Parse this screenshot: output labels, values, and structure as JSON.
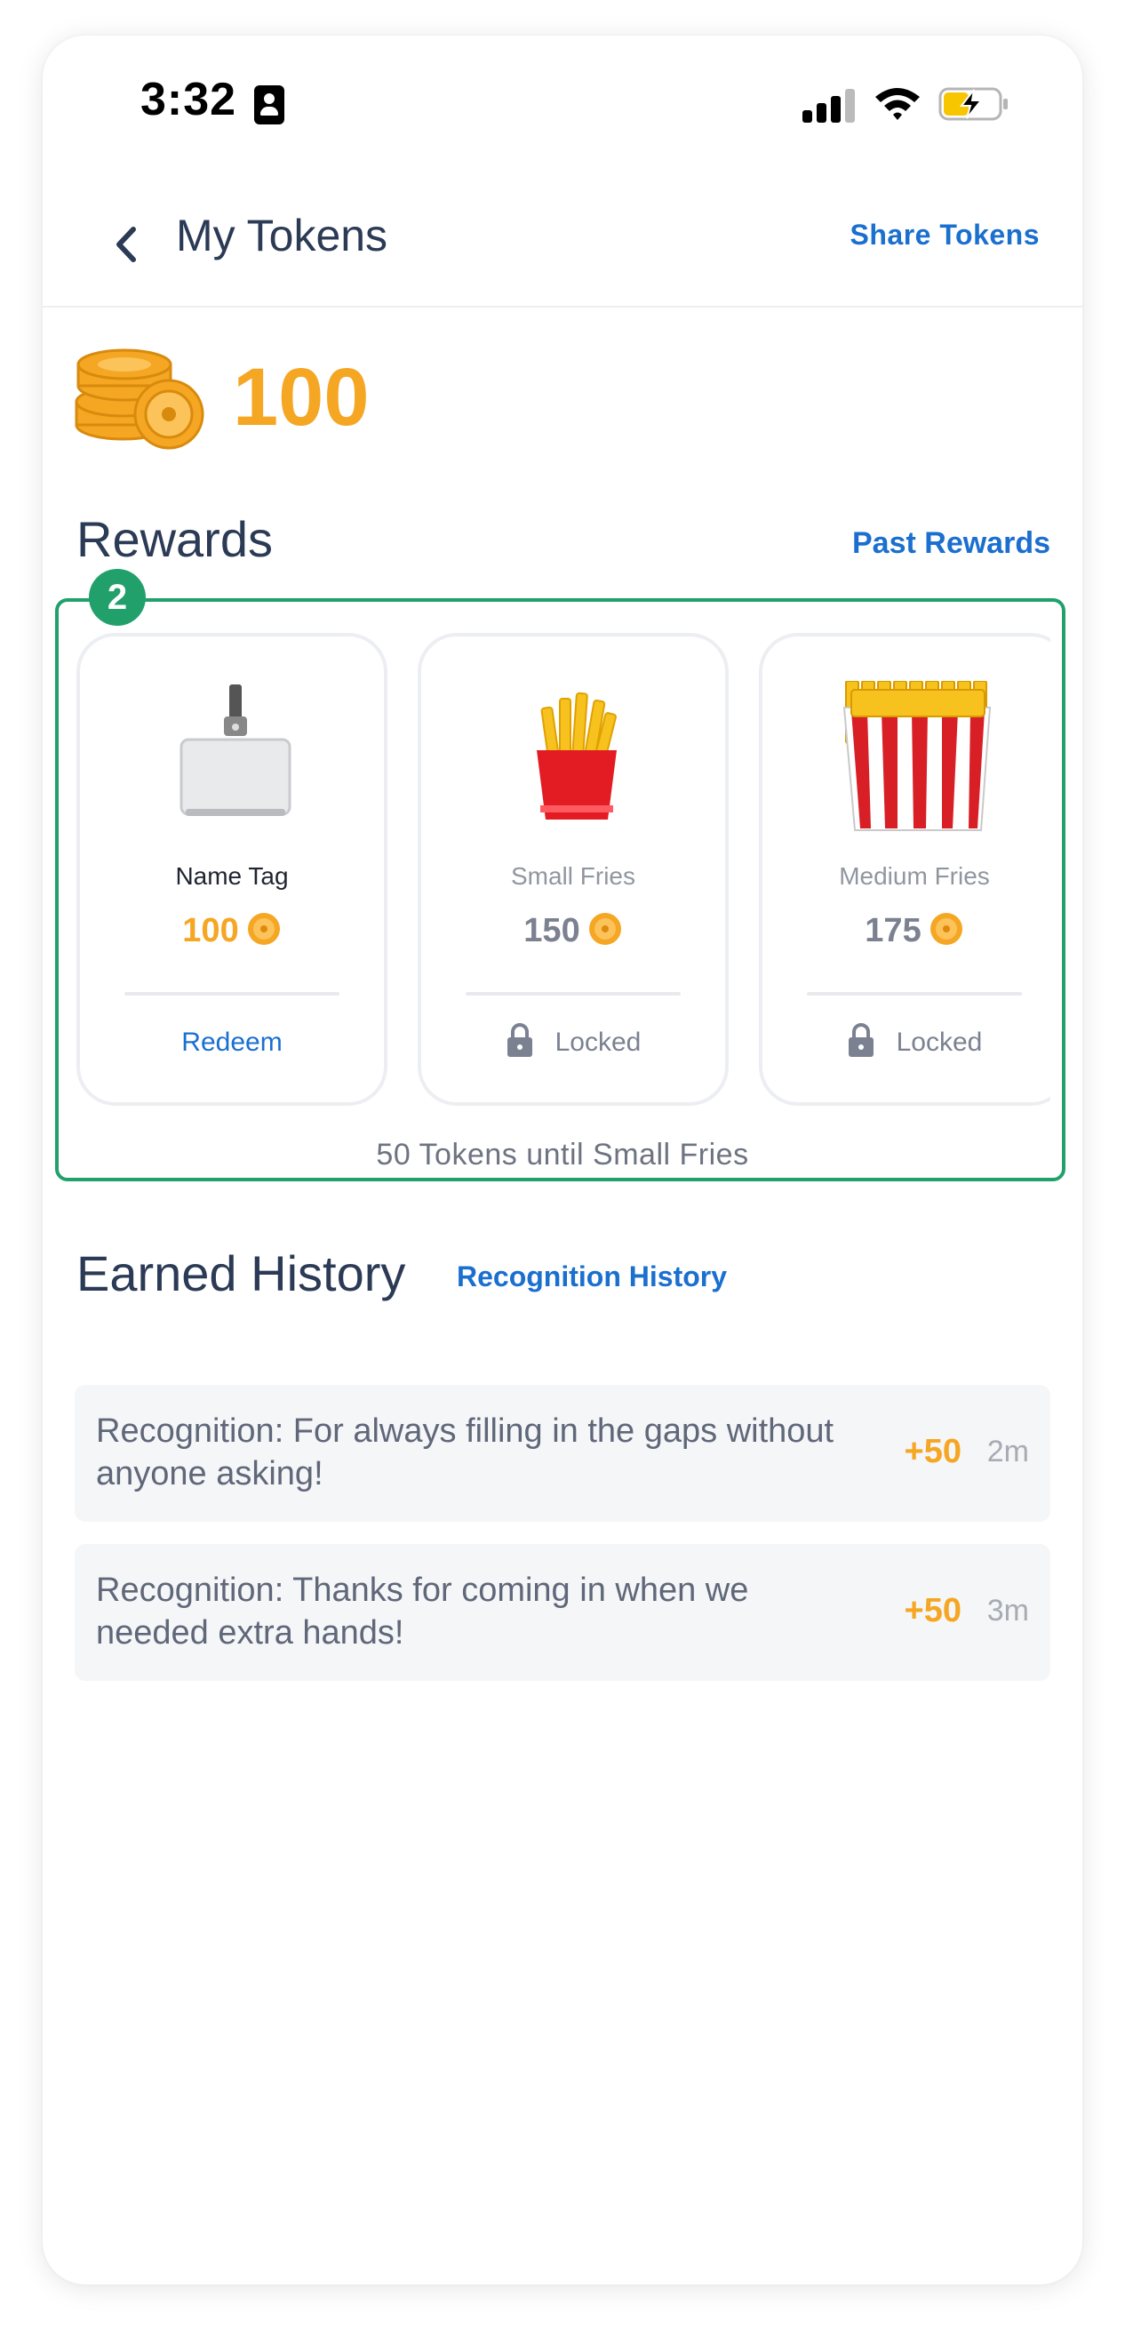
{
  "status": {
    "time": "3:32"
  },
  "nav": {
    "title": "My Tokens",
    "share_label": "Share Tokens"
  },
  "balance": {
    "value": "100"
  },
  "rewards": {
    "title": "Rewards",
    "past_label": "Past Rewards",
    "badge": "2",
    "items": [
      {
        "name": "Name Tag",
        "cost": "100",
        "action": "Redeem",
        "locked": false
      },
      {
        "name": "Small Fries",
        "cost": "150",
        "action": "Locked",
        "locked": true
      },
      {
        "name": "Medium Fries",
        "cost": "175",
        "action": "Locked",
        "locked": true
      }
    ],
    "progress_text": "50 Tokens until Small Fries"
  },
  "history": {
    "title": "Earned History",
    "recognition_link": "Recognition History",
    "items": [
      {
        "text": "Recognition:  For always filling in the gaps without anyone asking!",
        "points": "+50",
        "time": "2m"
      },
      {
        "text": "Recognition:  Thanks for coming in when we needed extra hands!",
        "points": "+50",
        "time": "3m"
      }
    ]
  },
  "colors": {
    "accent_blue": "#1a6fcf",
    "token_orange": "#f5a623",
    "highlight_green": "#22a06b",
    "title_navy": "#2b3a55"
  }
}
